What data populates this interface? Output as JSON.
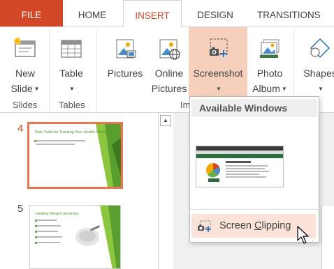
{
  "tabs": {
    "file": "FILE",
    "home": "HOME",
    "insert": "INSERT",
    "design": "DESIGN",
    "transitions": "TRANSITIONS"
  },
  "ribbon": {
    "new_slide": {
      "line1": "New",
      "line2": "Slide"
    },
    "table": {
      "line1": "Table"
    },
    "pictures": {
      "line1": "Pictures"
    },
    "online_pictures": {
      "line1": "Online",
      "line2": "Pictures"
    },
    "screenshot": {
      "line1": "Screenshot"
    },
    "photo_album": {
      "line1": "Photo",
      "line2": "Album"
    },
    "shapes": {
      "line1": "Shapes"
    },
    "groups": {
      "slides": "Slides",
      "tables": "Tables",
      "images_partial": "Im"
    }
  },
  "slides": [
    {
      "number": "4",
      "title": "Web Tools for Tracking Your Health Goals",
      "selected": true
    },
    {
      "number": "5",
      "title": "Healthy Weight Seminars",
      "selected": false
    }
  ],
  "screenshot_menu": {
    "header": "Available Windows",
    "clip_label_pre": "Screen ",
    "clip_label_accel": "C",
    "clip_label_post": "lipping"
  },
  "colors": {
    "accent": "#d24726",
    "selection_fill": "#f6cfbd",
    "hover_fill": "#fbe3d9",
    "slide_green": "#6ab04c"
  },
  "icons": [
    "new-slide-icon",
    "table-icon",
    "pictures-icon",
    "online-pictures-icon",
    "screenshot-icon",
    "photo-album-icon",
    "shapes-icon",
    "screen-clipping-icon",
    "pointer-cursor-icon"
  ]
}
